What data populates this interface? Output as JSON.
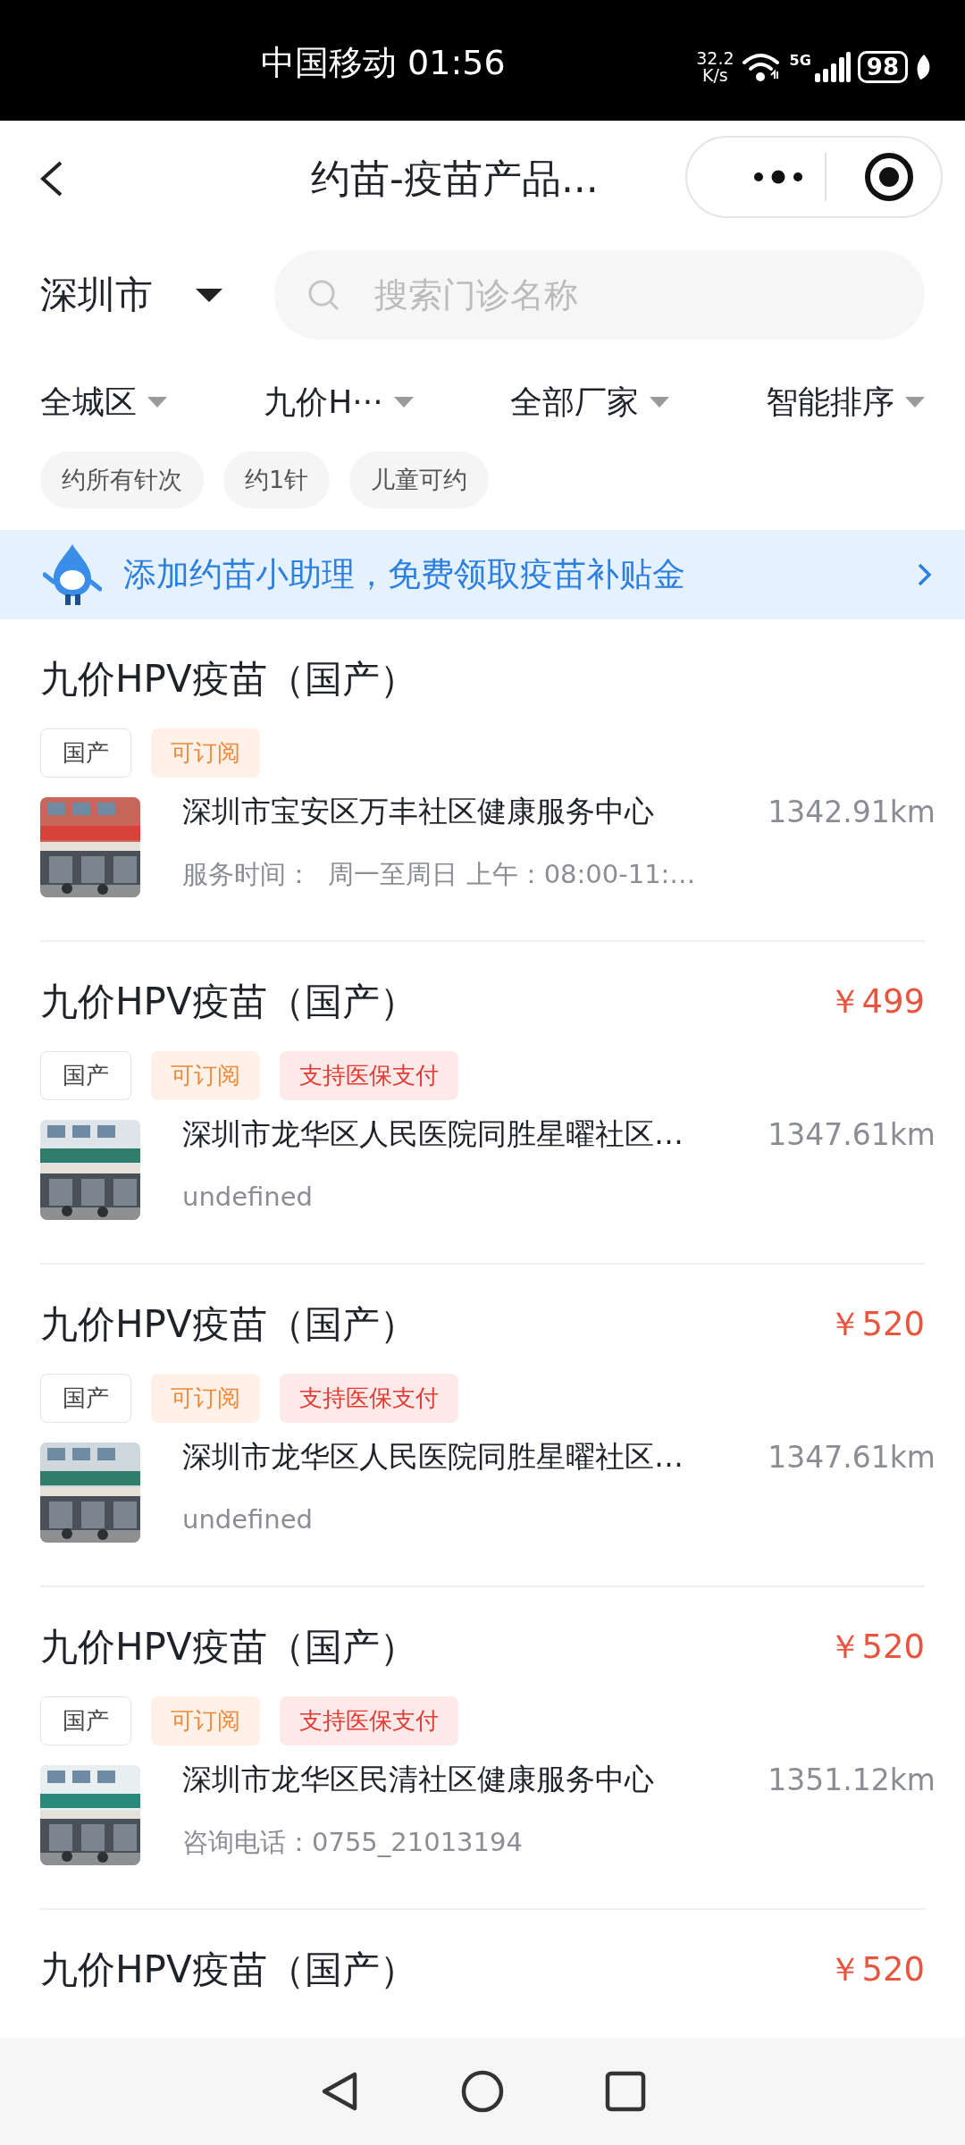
{
  "status_bar": {
    "carrier": "中国移动",
    "time": "01:56",
    "speed_value": "32.2",
    "speed_unit": "K/s",
    "network": "5G",
    "battery": "98"
  },
  "header": {
    "title": "约苗-疫苗产品..."
  },
  "location": {
    "city": "深圳市"
  },
  "search": {
    "placeholder": "搜索门诊名称"
  },
  "filters": [
    {
      "label": "全城区"
    },
    {
      "label": "九价H···"
    },
    {
      "label": "全部厂家"
    },
    {
      "label": "智能排序"
    }
  ],
  "chips": [
    {
      "label": "约所有针次"
    },
    {
      "label": "约1针"
    },
    {
      "label": "儿童可约"
    }
  ],
  "banner": {
    "text": "添加约苗小助理，免费领取疫苗补贴金"
  },
  "products": [
    {
      "title": "九价HPV疫苗（国产）",
      "tags": [
        {
          "label": "国产",
          "kind": "origin"
        },
        {
          "label": "可订阅",
          "kind": "subscribe"
        }
      ],
      "clinic": "深圳市宝安区万丰社区健康服务中心",
      "distance": "1342.91km",
      "detail": "服务时间：  周一至周日 上午：08:00-11:…"
    },
    {
      "title": "九价HPV疫苗（国产）",
      "price": "￥499",
      "tags": [
        {
          "label": "国产",
          "kind": "origin"
        },
        {
          "label": "可订阅",
          "kind": "subscribe"
        },
        {
          "label": "支持医保支付",
          "kind": "insurance"
        }
      ],
      "clinic": "深圳市龙华区人民医院同胜星曜社区…",
      "distance": "1347.61km",
      "detail": "undefined"
    },
    {
      "title": "九价HPV疫苗（国产）",
      "price": "￥520",
      "tags": [
        {
          "label": "国产",
          "kind": "origin"
        },
        {
          "label": "可订阅",
          "kind": "subscribe"
        },
        {
          "label": "支持医保支付",
          "kind": "insurance"
        }
      ],
      "clinic": "深圳市龙华区人民医院同胜星曜社区…",
      "distance": "1347.61km",
      "detail": "undefined"
    },
    {
      "title": "九价HPV疫苗（国产）",
      "price": "￥520",
      "tags": [
        {
          "label": "国产",
          "kind": "origin"
        },
        {
          "label": "可订阅",
          "kind": "subscribe"
        },
        {
          "label": "支持医保支付",
          "kind": "insurance"
        }
      ],
      "clinic": "深圳市龙华区民清社区健康服务中心",
      "distance": "1351.12km",
      "detail": "咨询电话：0755_21013194"
    },
    {
      "title": "九价HPV疫苗（国产）",
      "price": "￥520"
    }
  ]
}
